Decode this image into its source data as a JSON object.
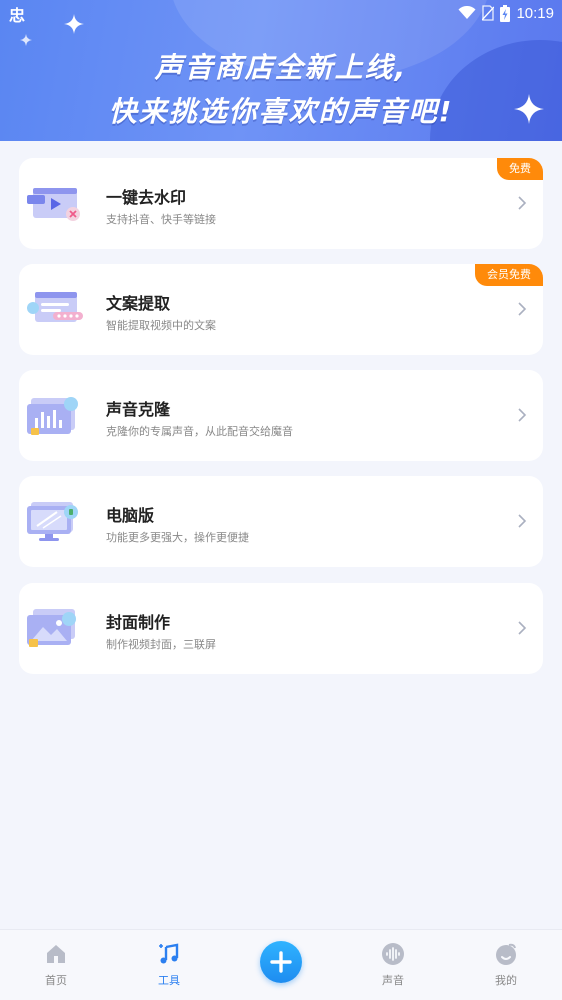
{
  "status_bar": {
    "carrier_glyph": "忠",
    "time": "10:19",
    "icons": [
      "wifi-icon",
      "no-sim-icon",
      "battery-charging-icon"
    ]
  },
  "banner": {
    "line1": "声音商店全新上线,",
    "line2": "快来挑选你喜欢的声音吧!"
  },
  "tools": [
    {
      "title": "一键去水印",
      "desc": "支持抖音、快手等链接",
      "badge": "免费",
      "icon": "watermark-remove-icon"
    },
    {
      "title": "文案提取",
      "desc": "智能提取视频中的文案",
      "badge": "会员免费",
      "icon": "text-extract-icon"
    },
    {
      "title": "声音克隆",
      "desc": "克隆你的专属声音，从此配音交给魔音",
      "badge": "",
      "icon": "voice-clone-icon"
    },
    {
      "title": "电脑版",
      "desc": "功能更多更强大，操作更便捷",
      "badge": "",
      "icon": "desktop-icon"
    },
    {
      "title": "封面制作",
      "desc": "制作视频封面，三联屏",
      "badge": "",
      "icon": "cover-maker-icon"
    }
  ],
  "bottom_nav": {
    "items": [
      {
        "label": "首页",
        "icon": "home-icon",
        "active": false
      },
      {
        "label": "工具",
        "icon": "music-note-icon",
        "active": true
      },
      {
        "label": "",
        "icon": "plus-icon",
        "active": false
      },
      {
        "label": "声音",
        "icon": "voice-wave-icon",
        "active": false
      },
      {
        "label": "我的",
        "icon": "profile-icon",
        "active": false
      }
    ]
  },
  "colors": {
    "accent": "#2b7ff0",
    "badge": "#ff8a0a",
    "banner_start": "#5a86f2",
    "banner_end": "#5a78ee",
    "background": "#f3f5fc"
  }
}
